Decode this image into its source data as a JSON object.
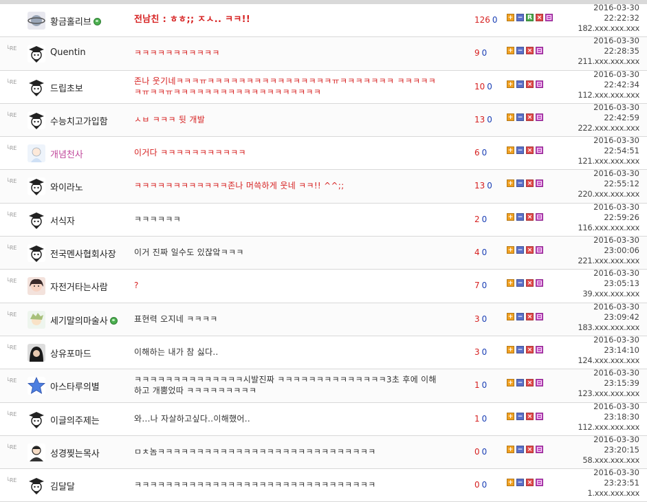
{
  "buttons": {
    "plus": "+",
    "minus": "−",
    "reply": "R",
    "delete": "×",
    "report": "신고"
  },
  "reply_marker": "└RE",
  "comments": [
    {
      "nick": "황금홀리브",
      "online": true,
      "text": "전남친 : ㅎㅎ;; ㅈㅅ.. ㅋㅋ!!",
      "up": "126",
      "down": "0",
      "date": "2016-03-30",
      "time": "22:22:32",
      "ip": "182.xxx.xxx.xxx"
    },
    {
      "nick": "Quentin",
      "online": false,
      "text": "ㅋㅋㅋㅋㅋㅋㅋㅋㅋㅋㅋ",
      "up": "9",
      "down": "0",
      "date": "2016-03-30",
      "time": "22:28:35",
      "ip": "211.xxx.xxx.xxx"
    },
    {
      "nick": "드립초보",
      "online": false,
      "text": "존나 웃기네ㅋㅋㅋㅠㅋㅋㅋㅋㅋㅋㅋㅋㅋㅋㅋㅋㅋㅋㅋㅋㅠㅋㅋㅋㅋㅋㅋㅋ ㅋㅋㅋㅋㅋㅋㅠㅋㅋㅠㅋㅋㅋㅋㅋㅋㅋㅋㅋㅋㅋㅋㅋㅋㅋㅋㅋㅋㅋ",
      "up": "10",
      "down": "0",
      "date": "2016-03-30",
      "time": "22:42:34",
      "ip": "112.xxx.xxx.xxx"
    },
    {
      "nick": "수능치고가입함",
      "online": false,
      "text": "ㅅㅂ ㅋㅋㅋ 뒷 개발",
      "up": "13",
      "down": "0",
      "date": "2016-03-30",
      "time": "22:42:59",
      "ip": "222.xxx.xxx.xxx"
    },
    {
      "nick": "개념천사",
      "online": false,
      "text": "이거다 ㅋㅋㅋㅋㅋㅋㅋㅋㅋㅋㅋ",
      "up": "6",
      "down": "0",
      "date": "2016-03-30",
      "time": "22:54:51",
      "ip": "121.xxx.xxx.xxx"
    },
    {
      "nick": "와이라노",
      "online": false,
      "text": "ㅋㅋㅋㅋㅋㅋㅋㅋㅋㅋㅋㅋ존나 머쓱하게 웃네 ㅋㅋ!! ^^;;",
      "up": "13",
      "down": "0",
      "date": "2016-03-30",
      "time": "22:55:12",
      "ip": "220.xxx.xxx.xxx"
    },
    {
      "nick": "서식자",
      "online": false,
      "text": "ㅋㅋㅋㅋㅋㅋ",
      "up": "2",
      "down": "0",
      "date": "2016-03-30",
      "time": "22:59:26",
      "ip": "116.xxx.xxx.xxx"
    },
    {
      "nick": "전국멘사협회사장",
      "online": false,
      "text": "이거 진짜 일수도 있잖앜ㅋㅋㅋ",
      "up": "4",
      "down": "0",
      "date": "2016-03-30",
      "time": "23:00:06",
      "ip": "221.xxx.xxx.xxx"
    },
    {
      "nick": "자전거타는사람",
      "online": false,
      "text": "?",
      "up": "7",
      "down": "0",
      "date": "2016-03-30",
      "time": "23:05:13",
      "ip": "39.xxx.xxx.xxx"
    },
    {
      "nick": "세기말의마술사",
      "online": true,
      "text": "표현력 오지네 ㅋㅋㅋㅋ",
      "up": "3",
      "down": "0",
      "date": "2016-03-30",
      "time": "23:09:42",
      "ip": "183.xxx.xxx.xxx"
    },
    {
      "nick": "상유포마드",
      "online": false,
      "text": "이해하는 내가 참 싫다..",
      "up": "3",
      "down": "0",
      "date": "2016-03-30",
      "time": "23:14:10",
      "ip": "124.xxx.xxx.xxx"
    },
    {
      "nick": "아스타루의별",
      "online": false,
      "text": "ㅋㅋㅋㅋㅋㅋㅋㅋㅋㅋㅋㅋㅋㅋ시발진짜 ㅋㅋㅋㅋㅋㅋㅋㅋㅋㅋㅋㅋㅋㅋ3초 후에 이해하고 개뿜었따 ㅋㅋㅋㅋㅋㅋㅋㅋㅋ",
      "up": "1",
      "down": "0",
      "date": "2016-03-30",
      "time": "23:15:39",
      "ip": "123.xxx.xxx.xxx"
    },
    {
      "nick": "이글의주제는",
      "online": false,
      "text": "와...나 자살하고싶다..이해했어..",
      "up": "1",
      "down": "0",
      "date": "2016-03-30",
      "time": "23:18:30",
      "ip": "112.xxx.xxx.xxx"
    },
    {
      "nick": "성경찢는목사",
      "online": false,
      "text": "ㅁㅊ놈ㅋㅋㅋㅋㅋㅋㅋㅋㅋㅋㅋㅋㅋㅋㅋㅋㅋㅋㅋㅋㅋㅋㅋㅋㅋㅋㅋㅋ",
      "up": "0",
      "down": "0",
      "date": "2016-03-30",
      "time": "23:20:15",
      "ip": "58.xxx.xxx.xxx"
    },
    {
      "nick": "김달달",
      "online": false,
      "text": "ㅋㅋㅋㅋㅋㅋㅋㅋㅋㅋㅋㅋㅋㅋㅋㅋㅋㅋㅋㅋㅋㅋㅋㅋㅋㅋㅋㅋㅋㅋㅋ",
      "up": "0",
      "down": "0",
      "date": "2016-03-30",
      "time": "23:23:51",
      "ip": "1.xxx.xxx.xxx"
    }
  ]
}
